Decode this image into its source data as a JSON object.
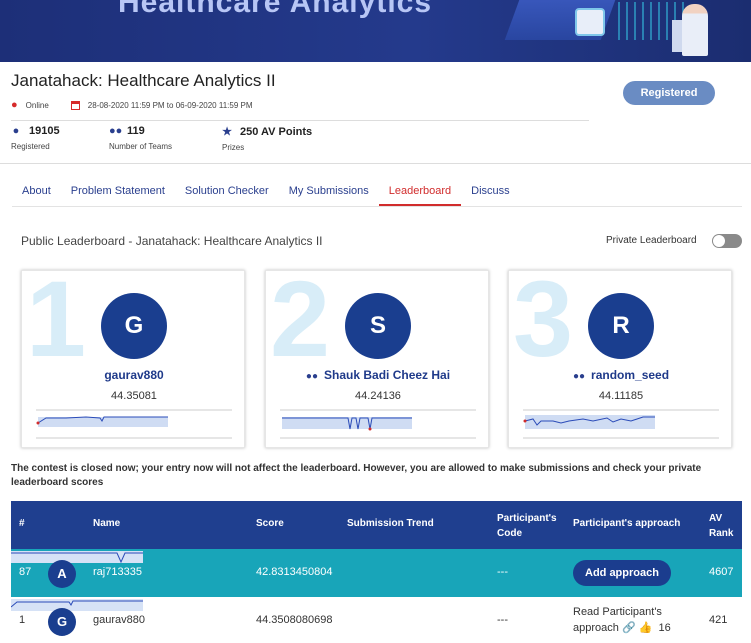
{
  "banner": {
    "text": "Healthcare Analytics"
  },
  "header": {
    "title": "Janatahack: Healthcare Analytics II",
    "location": "Online",
    "dates": "28-08-2020 11:59 PM to 06-09-2020 11:59 PM",
    "register_label": "Registered"
  },
  "stats": [
    {
      "value": "19105",
      "label": "Registered",
      "icon": "user-icon"
    },
    {
      "value": "119",
      "label": "Number of Teams",
      "icon": "team-icon"
    },
    {
      "value": "250 AV Points",
      "label": "Prizes",
      "icon": "trophy-icon"
    }
  ],
  "tabs": [
    {
      "label": "About"
    },
    {
      "label": "Problem Statement"
    },
    {
      "label": "Solution Checker"
    },
    {
      "label": "My Submissions"
    },
    {
      "label": "Leaderboard",
      "active": true
    },
    {
      "label": "Discuss"
    }
  ],
  "leaderboard": {
    "public_title": "Public Leaderboard - Janatahack: Healthcare Analytics II",
    "private_label": "Private Leaderboard",
    "private_on": false
  },
  "podium": [
    {
      "rank": "1",
      "initial": "G",
      "name": "gaurav880",
      "team": false,
      "score": "44.35081"
    },
    {
      "rank": "2",
      "initial": "S",
      "name": "Shauk Badi Cheez Hai",
      "team": true,
      "score": "44.24136"
    },
    {
      "rank": "3",
      "initial": "R",
      "name": "random_seed",
      "team": true,
      "score": "44.11185"
    }
  ],
  "notice": "The contest is closed now; your entry now will not affect the leaderboard. However, you are allowed to make submissions and check your private leaderboard scores",
  "table": {
    "headers": {
      "rank": "#",
      "name": "Name",
      "score": "Score",
      "trend": "Submission Trend",
      "code": "Participant's Code",
      "approach": "Participant's approach",
      "av_rank": "AV Rank"
    },
    "rows": [
      {
        "rank": "87",
        "initial": "A",
        "name": "raj713335",
        "score": "42.8313450804",
        "code": "---",
        "approach": "Add approach",
        "av_rank": "4607"
      },
      {
        "rank": "1",
        "initial": "G",
        "name": "gaurav880",
        "score": "44.3508080698",
        "code": "---",
        "approach": "Read Participant's approach",
        "likes": "16",
        "av_rank": "421"
      }
    ]
  },
  "colors": {
    "primary": "#1f3f8f",
    "highlight_row": "#18a5b9",
    "active_tab": "#d12c2c",
    "register_button": "#6a8cc3"
  }
}
